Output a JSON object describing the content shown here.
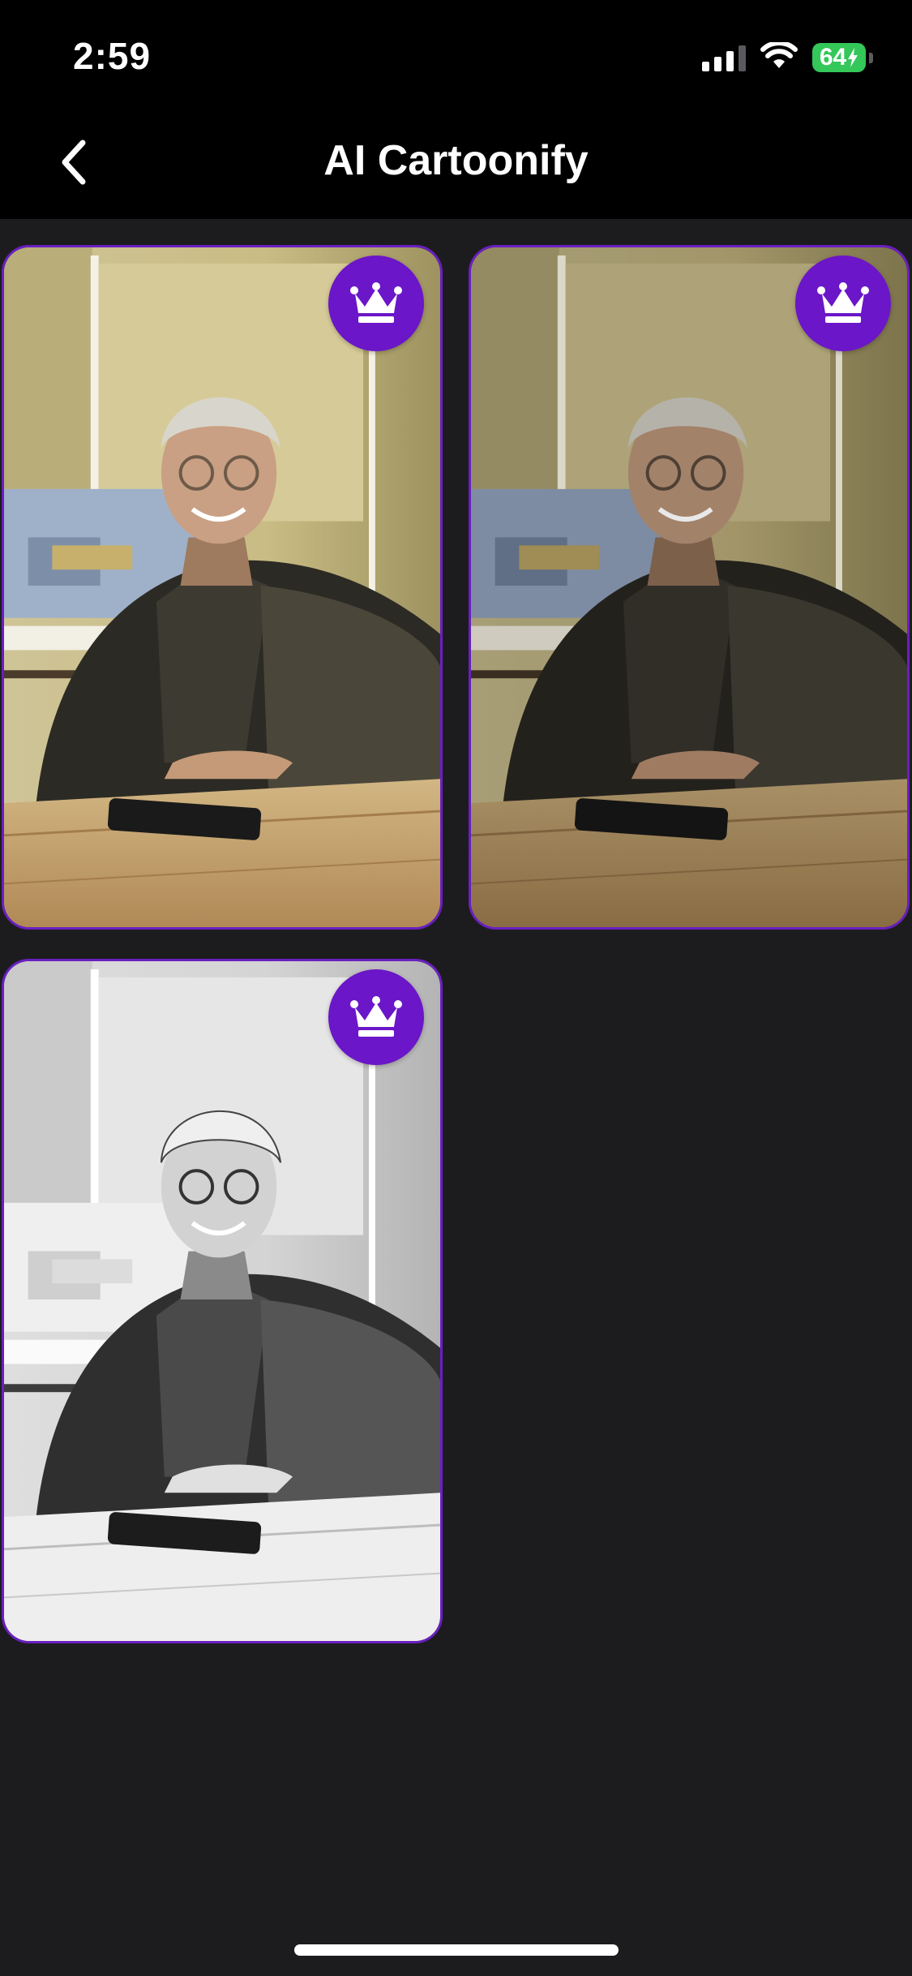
{
  "status_bar": {
    "time": "2:59",
    "battery": "64",
    "icons": [
      "signal-icon",
      "wifi-icon",
      "battery-charging-icon"
    ]
  },
  "header": {
    "title": "AI Cartoonify",
    "back_icon": "chevron-left-icon"
  },
  "results": [
    {
      "style": "color",
      "premium": true,
      "icon": "crown-icon"
    },
    {
      "style": "dark-color",
      "premium": true,
      "icon": "crown-icon"
    },
    {
      "style": "black-and-white",
      "premium": true,
      "icon": "crown-icon"
    }
  ],
  "colors": {
    "background": "#1c1c1e",
    "header": "#000000",
    "accent": "#6b16c8",
    "battery": "#34c759"
  }
}
